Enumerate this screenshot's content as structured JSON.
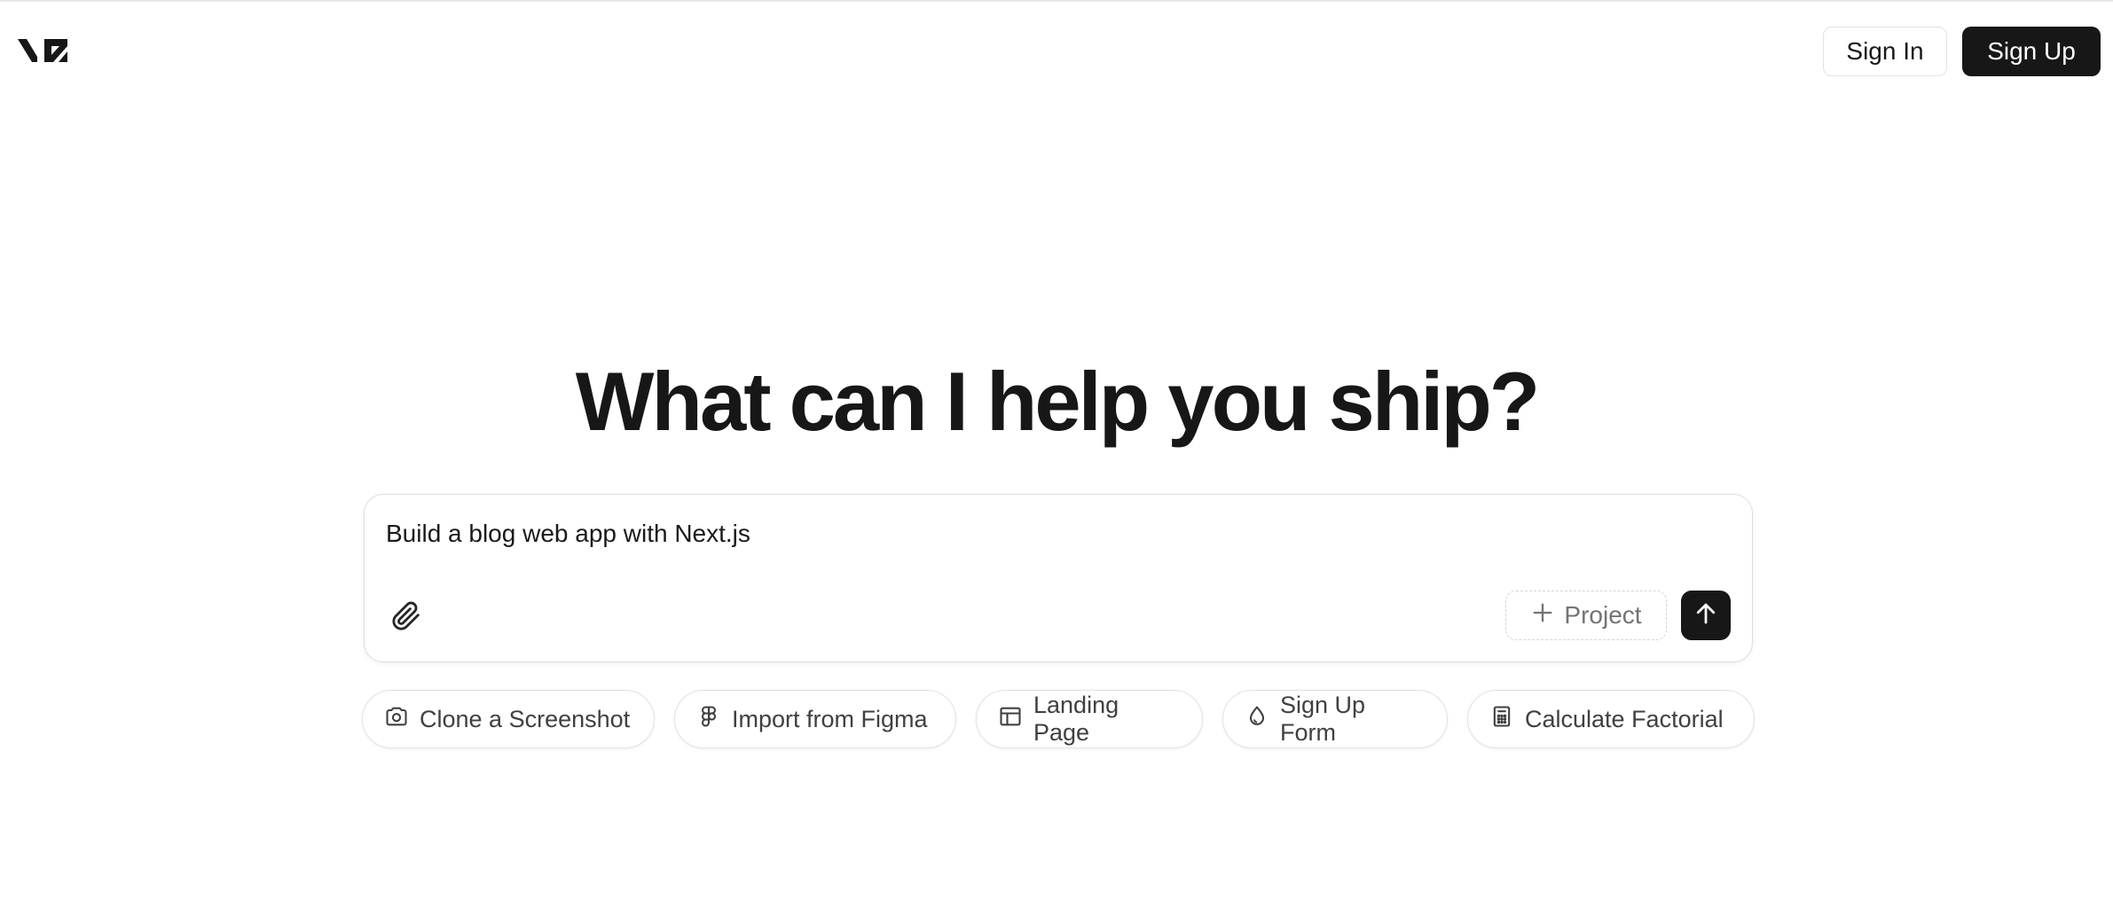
{
  "header": {
    "logo_icon": "v0-logo",
    "sign_in_label": "Sign In",
    "sign_up_label": "Sign Up"
  },
  "hero": {
    "title": "What can I help you ship?"
  },
  "prompt": {
    "value": "Build a blog web app with Next.js",
    "attach_icon": "paperclip-icon",
    "project_label": "Project",
    "project_icon": "plus-icon",
    "send_icon": "arrow-up-icon"
  },
  "suggestions": [
    {
      "label": "Clone a Screenshot",
      "icon": "camera-icon"
    },
    {
      "label": "Import from Figma",
      "icon": "figma-icon"
    },
    {
      "label": "Landing Page",
      "icon": "layout-icon"
    },
    {
      "label": "Sign Up Form",
      "icon": "droplet-icon"
    },
    {
      "label": "Calculate Factorial",
      "icon": "calculator-icon"
    }
  ],
  "colors": {
    "primary": "#171717",
    "border": "#e2e2e2",
    "muted_text": "#737373"
  }
}
